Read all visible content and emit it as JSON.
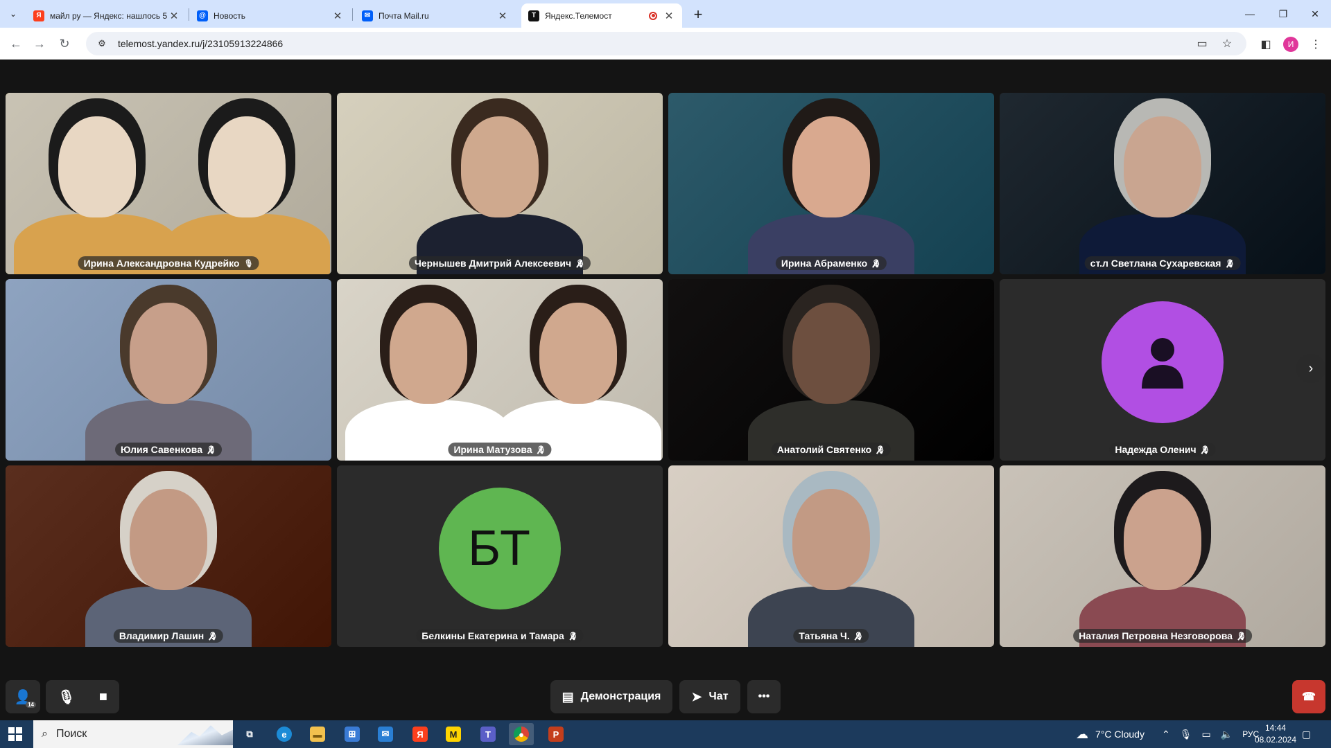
{
  "browser": {
    "tabs": [
      {
        "title": "майл ру — Яндекс: нашлось 5",
        "favicon_letter": "Я",
        "favicon_color": "#fc3f1d",
        "active": false
      },
      {
        "title": "Новость",
        "favicon_letter": "@",
        "favicon_color": "#005ff9",
        "active": false
      },
      {
        "title": "Почта Mail.ru",
        "favicon_letter": "✉",
        "favicon_color": "#005ff9",
        "active": false
      },
      {
        "title": "Яндекс.Телемост",
        "favicon_letter": "Т",
        "favicon_color": "#111111",
        "active": true
      }
    ],
    "url": "telemost.yandex.ru/j/23105913224866",
    "profile_initial": "И",
    "icons": {
      "back": "arrow-left-icon",
      "forward": "arrow-right-icon",
      "reload": "reload-icon",
      "site_info": "tune-icon",
      "camera": "camera-icon",
      "bookmark": "star-icon",
      "sidepanel": "side-panel-icon",
      "menu": "kebab-menu-icon"
    }
  },
  "meeting": {
    "participants": [
      {
        "name": "Ирина Александровна Кудрейко",
        "muted": false,
        "speaking": true,
        "type": "video",
        "palette": [
          "#c9c3b4",
          "#e8d7c3",
          "#1b1b1b",
          "#d8a24e"
        ]
      },
      {
        "name": "Чернышев Дмитрий Алексеевич",
        "muted": true,
        "speaking": false,
        "type": "video",
        "palette": [
          "#d6d0bd",
          "#cfa98e",
          "#3a2a1f",
          "#1c2130"
        ]
      },
      {
        "name": "Ирина Абраменко",
        "muted": true,
        "speaking": false,
        "type": "video",
        "palette": [
          "#2d5a6a",
          "#d9a98f",
          "#201a17",
          "#3a3f63"
        ]
      },
      {
        "name": "ст.л Светлана Сухаревская",
        "muted": true,
        "speaking": false,
        "type": "video",
        "palette": [
          "#1f2830",
          "#c9a590",
          "#b8b8b4",
          "#0e1a38"
        ]
      },
      {
        "name": "Юлия Савенкова",
        "muted": true,
        "speaking": false,
        "type": "video",
        "palette": [
          "#8ea3c0",
          "#c79f8a",
          "#4a3a2c",
          "#6d6a78"
        ]
      },
      {
        "name": "Ирина Матузова",
        "muted": true,
        "speaking": false,
        "type": "video",
        "palette": [
          "#d9d4c8",
          "#d0a88e",
          "#2a1e18",
          "#ffffff"
        ]
      },
      {
        "name": "Анатолий Святенко",
        "muted": true,
        "speaking": false,
        "type": "video",
        "palette": [
          "#121010",
          "#6d4f3f",
          "#2a2420",
          "#2e2e2a"
        ]
      },
      {
        "name": "Надежда Оленич",
        "muted": true,
        "speaking": false,
        "type": "avatar",
        "avatar_color": "#b14fe3",
        "icon": "person-icon"
      },
      {
        "name": "Владимир Лашин",
        "muted": true,
        "speaking": false,
        "type": "video",
        "palette": [
          "#5a2e1e",
          "#c39a84",
          "#d6d1c8",
          "#5c6477"
        ]
      },
      {
        "name": "Белкины Екатерина и Тамара",
        "muted": true,
        "speaking": false,
        "type": "avatar",
        "avatar_color": "#5fb651",
        "initials": "БТ"
      },
      {
        "name": "Татьяна Ч.",
        "muted": true,
        "speaking": false,
        "type": "video",
        "palette": [
          "#d8cfc4",
          "#c29a84",
          "#a9b9c2",
          "#3d4451"
        ]
      },
      {
        "name": "Наталия Петровна Незговорова",
        "muted": true,
        "speaking": false,
        "type": "video",
        "palette": [
          "#c9c2b8",
          "#cba28d",
          "#1d1a1c",
          "#8a4a52"
        ]
      }
    ],
    "controls": {
      "invite_icon": "add-person-icon",
      "invite_badge": "14",
      "mic_icon": "microphone-icon",
      "camera_icon": "video-camera-icon",
      "screen_share_label": "Демонстрация",
      "chat_label": "Чат",
      "more_icon": "more-horizontal-icon",
      "hangup_icon": "hang-up-icon"
    },
    "next_page_icon": "chevron-right-icon"
  },
  "taskbar": {
    "search_label": "Поиск",
    "weather": "7°C  Cloudy",
    "language": "РУС",
    "time": "14:44",
    "date": "08.02.2024",
    "apps": [
      "task-view-icon",
      "edge-icon",
      "file-explorer-icon",
      "store-icon",
      "mail-icon",
      "yandex-browser-icon",
      "yandex-market-icon",
      "teams-icon",
      "chrome-icon",
      "powerpoint-icon"
    ]
  }
}
